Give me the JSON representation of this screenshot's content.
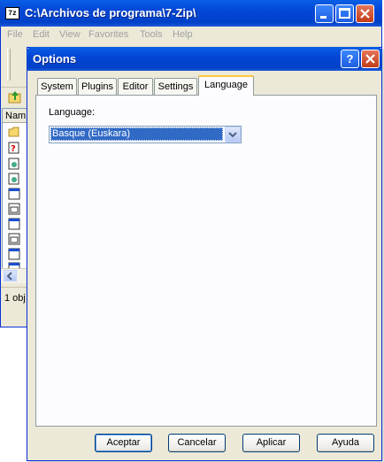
{
  "background_window": {
    "logo": "7z",
    "title": "C:\\Archivos de programa\\7-Zip\\",
    "menu": [
      "File",
      "Edit",
      "View",
      "Favorites",
      "Tools",
      "Help"
    ],
    "list_header": "Nam",
    "status_text": "1 obj"
  },
  "dialog": {
    "title": "Options",
    "help_glyph": "?",
    "close_glyph": "×",
    "tabs": [
      {
        "label": "System",
        "active": false
      },
      {
        "label": "Plugins",
        "active": false
      },
      {
        "label": "Editor",
        "active": false
      },
      {
        "label": "Settings",
        "active": false
      },
      {
        "label": "Language",
        "active": true
      }
    ],
    "language_label": "Language:",
    "language_value": "Basque (Euskara)",
    "buttons": {
      "ok": "Aceptar",
      "cancel": "Cancelar",
      "apply": "Aplicar",
      "help": "Ayuda"
    }
  },
  "colors": {
    "titlebar": "#0346d6",
    "selection": "#316ac5",
    "active_tab_accent": "#ffc83c",
    "dialog_face": "#ece9d8"
  }
}
